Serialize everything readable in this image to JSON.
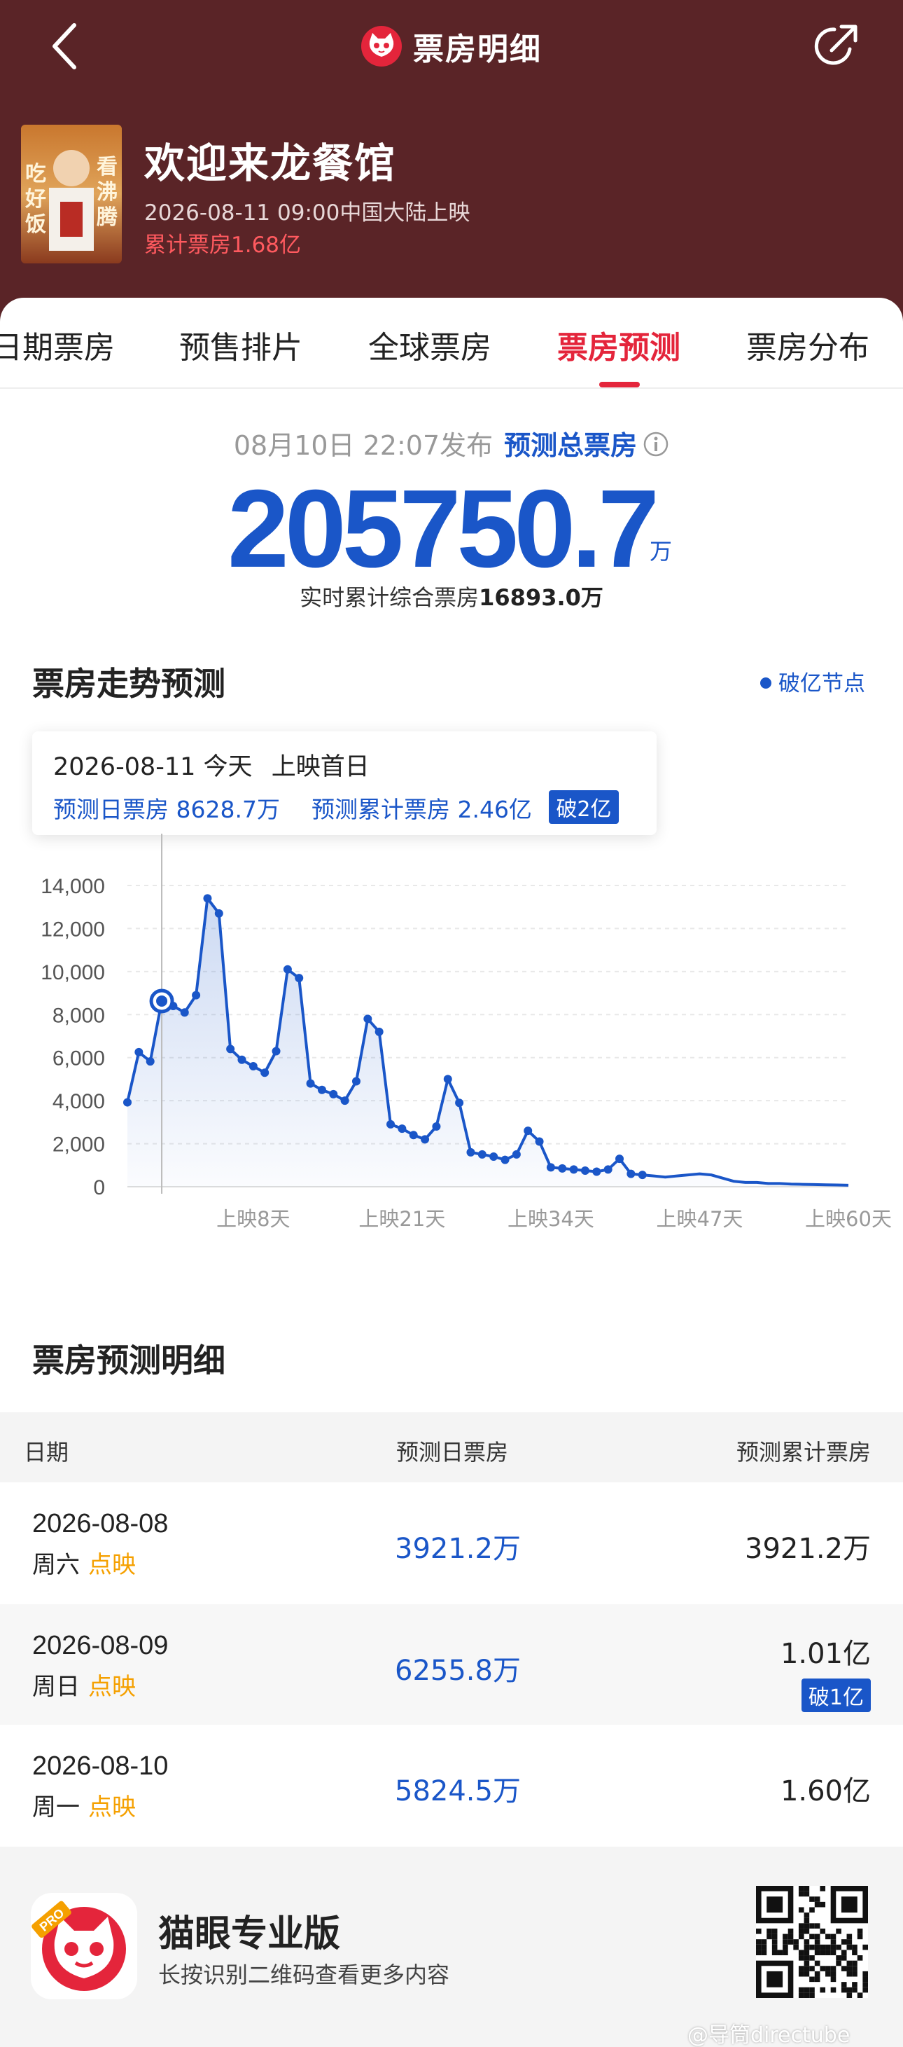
{
  "nav": {
    "title": "票房明细",
    "back_icon": "chevron-left-icon",
    "share_icon": "share-icon"
  },
  "movie": {
    "title": "欢迎来龙餐馆",
    "release": "2026-08-11 09:00中国大陆上映",
    "cumulative": "累计票房1.68亿",
    "poster_text": [
      "吃",
      "好",
      "饭",
      "看",
      "沸",
      "腾"
    ]
  },
  "tabs": [
    {
      "label": "日期票房",
      "active": false
    },
    {
      "label": "预售排片",
      "active": false
    },
    {
      "label": "全球票房",
      "active": false
    },
    {
      "label": "票房预测",
      "active": true
    },
    {
      "label": "票房分布",
      "active": false
    }
  ],
  "summary": {
    "publish": "08月10日  22:07发布",
    "predicted_total_label": "预测总票房",
    "predicted_total_value": "205750.7",
    "unit": "万",
    "realtime_label": "实时累计综合票房",
    "realtime_value": "16893.0万"
  },
  "chart_section": {
    "title": "票房走势预测",
    "legend": "破亿节点",
    "tooltip": {
      "date": "2026-08-11",
      "today": "今天",
      "desc": "上映首日",
      "daily": "预测日票房 8628.7万",
      "cumulative": "预测累计票房 2.46亿",
      "badge": "破2亿"
    }
  },
  "chart_data": {
    "type": "area",
    "y_ticks": [
      "14,000",
      "12,000",
      "10,000",
      "8,000",
      "6,000",
      "4,000",
      "2,000",
      "0"
    ],
    "ylim": [
      0,
      14000
    ],
    "x_ticks": [
      {
        "day": 8,
        "label": "上映8天"
      },
      {
        "day": 21,
        "label": "上映21天"
      },
      {
        "day": 34,
        "label": "上映34天"
      },
      {
        "day": 47,
        "label": "上映47天"
      },
      {
        "day": 60,
        "label": "上映60天"
      }
    ],
    "x": [
      -3,
      -2,
      -1,
      0,
      1,
      2,
      3,
      4,
      5,
      6,
      7,
      8,
      9,
      10,
      11,
      12,
      13,
      14,
      15,
      16,
      17,
      18,
      19,
      20,
      21,
      22,
      23,
      24,
      25,
      26,
      27,
      28,
      29,
      30,
      31,
      32,
      33,
      34,
      35,
      36,
      37,
      38,
      39,
      40,
      41,
      42,
      43,
      44,
      45,
      46,
      47,
      48,
      49,
      50,
      51,
      52,
      53,
      54,
      55,
      56,
      57,
      58,
      59,
      60
    ],
    "values": [
      3921,
      6256,
      5825,
      8629,
      8400,
      8100,
      8900,
      13400,
      12700,
      6400,
      5900,
      5600,
      5300,
      6300,
      10100,
      9700,
      4800,
      4500,
      4300,
      4000,
      4900,
      7800,
      7200,
      2900,
      2700,
      2400,
      2200,
      2800,
      5000,
      3900,
      1600,
      1500,
      1400,
      1250,
      1500,
      2600,
      2100,
      900,
      850,
      800,
      750,
      700,
      800,
      1300,
      600,
      550,
      500,
      450,
      500,
      550,
      600,
      550,
      400,
      250,
      200,
      200,
      150,
      150,
      120,
      110,
      100,
      90,
      80,
      70
    ],
    "highlight_x": 0,
    "dotted_x": [
      -3,
      -2,
      -1,
      1,
      2,
      3,
      4,
      5,
      6,
      7,
      8,
      9,
      10,
      11,
      12,
      13,
      14,
      15,
      16,
      17,
      18,
      19,
      20,
      21,
      22,
      23,
      24,
      25,
      26,
      27,
      28,
      29,
      30,
      31,
      32,
      33,
      34,
      35,
      36,
      37,
      38,
      39,
      40,
      41,
      42
    ],
    "color": "#1a56c8"
  },
  "table": {
    "title": "票房预测明细",
    "headers": [
      "日期",
      "预测日票房",
      "预测累计票房"
    ],
    "rows": [
      {
        "date": "2026-08-08",
        "weekday": "周六",
        "tag": "点映",
        "daily": "3921.2万",
        "cumulative": "3921.2万",
        "badge": ""
      },
      {
        "date": "2026-08-09",
        "weekday": "周日",
        "tag": "点映",
        "daily": "6255.8万",
        "cumulative": "1.01亿",
        "badge": "破1亿"
      },
      {
        "date": "2026-08-10",
        "weekday": "周一",
        "tag": "点映",
        "daily": "5824.5万",
        "cumulative": "1.60亿",
        "badge": ""
      }
    ]
  },
  "footer": {
    "app_name": "猫眼专业版",
    "hint": "长按识别二维码查看更多内容",
    "pro_badge": "PRO",
    "watermark": "@导筒directube"
  }
}
